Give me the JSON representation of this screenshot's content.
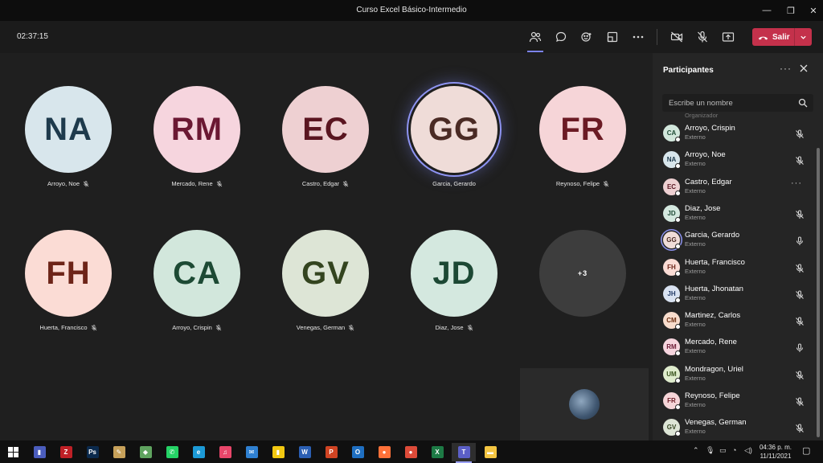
{
  "window": {
    "title": "Curso Excel Básico-Intermedio"
  },
  "toolbar": {
    "timer": "02:37:15",
    "leave_label": "Salir"
  },
  "stage": {
    "tiles": [
      {
        "initials": "NA",
        "name": "Arroyo, Noe",
        "bg": "#d8e6ec",
        "fg": "#1e3a4c",
        "speaking": false
      },
      {
        "initials": "RM",
        "name": "Mercado, Rene",
        "bg": "#f6d5de",
        "fg": "#6b1833",
        "speaking": false
      },
      {
        "initials": "EC",
        "name": "Castro, Edgar",
        "bg": "#eed0d2",
        "fg": "#5a1520",
        "speaking": false
      },
      {
        "initials": "GG",
        "name": "Garcia, Gerardo",
        "bg": "#efdcd8",
        "fg": "#4a2a24",
        "speaking": true
      },
      {
        "initials": "FR",
        "name": "Reynoso, Felipe",
        "bg": "#f6d5d8",
        "fg": "#6b1a24",
        "speaking": false
      },
      {
        "initials": "FH",
        "name": "Huerta, Francisco",
        "bg": "#fbdcd5",
        "fg": "#6d2418",
        "speaking": false
      },
      {
        "initials": "CA",
        "name": "Arroyo, Crispin",
        "bg": "#d2e7dc",
        "fg": "#1d4a34",
        "speaking": false
      },
      {
        "initials": "GV",
        "name": "Venegas, German",
        "bg": "#dde5d6",
        "fg": "#33441f",
        "speaking": false
      },
      {
        "initials": "JD",
        "name": "Diaz, Jose",
        "bg": "#d4e8df",
        "fg": "#1c4834",
        "speaking": false
      }
    ],
    "overflow_label": "+3"
  },
  "panel": {
    "title": "Participantes",
    "search_placeholder": "Escribe un nombre",
    "partial_role": "Organizador",
    "participants": [
      {
        "initials": "CA",
        "name": "Arroyo, Crispin",
        "role": "Externo",
        "bg": "#d2e7dc",
        "fg": "#1d4a34",
        "mic": "muted",
        "speaking": false
      },
      {
        "initials": "NA",
        "name": "Arroyo, Noe",
        "role": "Externo",
        "bg": "#d8e6ec",
        "fg": "#1e3a4c",
        "mic": "muted",
        "speaking": false
      },
      {
        "initials": "EC",
        "name": "Castro, Edgar",
        "role": "Externo",
        "bg": "#eed0d2",
        "fg": "#5a1520",
        "mic": "more",
        "speaking": false
      },
      {
        "initials": "JD",
        "name": "Diaz, Jose",
        "role": "Externo",
        "bg": "#d4e8df",
        "fg": "#1c4834",
        "mic": "muted",
        "speaking": false
      },
      {
        "initials": "GG",
        "name": "Garcia, Gerardo",
        "role": "Externo",
        "bg": "#efdcd8",
        "fg": "#4a2a24",
        "mic": "on",
        "speaking": true
      },
      {
        "initials": "FH",
        "name": "Huerta, Francisco",
        "role": "Externo",
        "bg": "#fbdcd5",
        "fg": "#6d2418",
        "mic": "muted",
        "speaking": false
      },
      {
        "initials": "JH",
        "name": "Huerta, Jhonatan",
        "role": "Externo",
        "bg": "#d9e2f1",
        "fg": "#233b66",
        "mic": "muted",
        "speaking": false
      },
      {
        "initials": "CM",
        "name": "Martinez, Carlos",
        "role": "Externo",
        "bg": "#f8dccc",
        "fg": "#6a2d10",
        "mic": "muted",
        "speaking": false
      },
      {
        "initials": "RM",
        "name": "Mercado, Rene",
        "role": "Externo",
        "bg": "#f6d5de",
        "fg": "#6b1833",
        "mic": "on",
        "speaking": false
      },
      {
        "initials": "UM",
        "name": "Mondragon, Uriel",
        "role": "Externo",
        "bg": "#dfeccd",
        "fg": "#36511a",
        "mic": "muted",
        "speaking": false
      },
      {
        "initials": "FR",
        "name": "Reynoso, Felipe",
        "role": "Externo",
        "bg": "#f6d5d8",
        "fg": "#6b1a24",
        "mic": "muted",
        "speaking": false
      },
      {
        "initials": "GV",
        "name": "Venegas, German",
        "role": "Externo",
        "bg": "#dde5d6",
        "fg": "#33441f",
        "mic": "muted",
        "speaking": false
      }
    ]
  },
  "taskbar": {
    "apps": [
      {
        "id": "start",
        "label": "",
        "color": "#ffffff"
      },
      {
        "id": "app-reports",
        "label": "▮",
        "color": "#4b5dbd"
      },
      {
        "id": "filezilla",
        "label": "Z",
        "color": "#bf2026"
      },
      {
        "id": "photoshop",
        "label": "Ps",
        "color": "#0b2a4d"
      },
      {
        "id": "app-pdf",
        "label": "✎",
        "color": "#c7a15a"
      },
      {
        "id": "app-maps",
        "label": "◆",
        "color": "#5fa35f"
      },
      {
        "id": "whatsapp",
        "label": "✆",
        "color": "#25d366"
      },
      {
        "id": "edge",
        "label": "e",
        "color": "#1c9ad6"
      },
      {
        "id": "itunes",
        "label": "♫",
        "color": "#e8466a"
      },
      {
        "id": "mail",
        "label": "✉",
        "color": "#2f80d1"
      },
      {
        "id": "powerbi",
        "label": "▮",
        "color": "#f2c811"
      },
      {
        "id": "word",
        "label": "W",
        "color": "#2b5fb3"
      },
      {
        "id": "powerpoint",
        "label": "P",
        "color": "#d04423"
      },
      {
        "id": "outlook",
        "label": "O",
        "color": "#1f6fc1"
      },
      {
        "id": "firefox",
        "label": "●",
        "color": "#ff7139"
      },
      {
        "id": "chrome",
        "label": "●",
        "color": "#dd4b39"
      },
      {
        "id": "excel",
        "label": "X",
        "color": "#1d7a45"
      },
      {
        "id": "teams",
        "label": "T",
        "color": "#5b5fc7"
      },
      {
        "id": "explorer",
        "label": "▬",
        "color": "#f4c542"
      }
    ],
    "active_app": "teams",
    "time": "04:36 p. m.",
    "date": "11/11/2021"
  }
}
